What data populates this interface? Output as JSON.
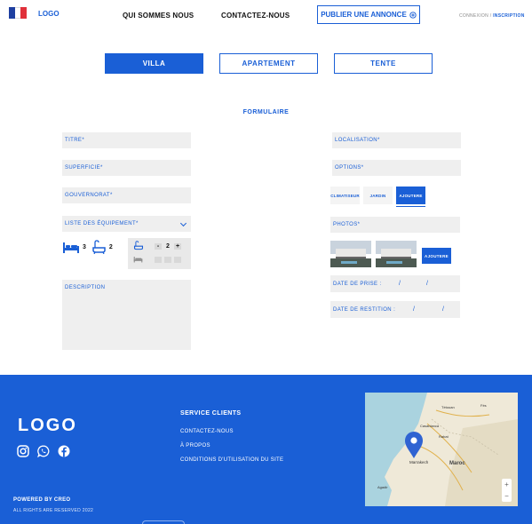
{
  "header": {
    "logo": "LOGO",
    "flag_colors": [
      "#1e3fa0",
      "#ffffff",
      "#e0303a"
    ],
    "nav": [
      {
        "label": "QUI SOMMES NOUS"
      },
      {
        "label": "CONTACTEZ-NOUS"
      }
    ],
    "publish_label": "PUBLIER UNE ANNONCE",
    "publish_icon": "plus-circle-icon",
    "login": "CONNEXION",
    "auth_separator": "/",
    "register": "INSCRIPTION"
  },
  "tabs": [
    {
      "label": "VILLA",
      "active": true
    },
    {
      "label": "APARTEMENT",
      "active": false
    },
    {
      "label": "TENTE",
      "active": false
    }
  ],
  "form": {
    "title": "FORMULAIRE",
    "left": {
      "titre": "TITRE*",
      "superficie": "SUPERFICIE*",
      "gouvernorat": "GOUVERNORAT*",
      "equipements": "LISTE DES ÉQUIPEMENT*",
      "bed_count": "3",
      "bath_count": "2",
      "stepper_value": "2",
      "stepper_minus": "-",
      "stepper_plus": "+",
      "description": "DESCRIPTION"
    },
    "right": {
      "localisation": "LOCALISATION*",
      "options": "OPTIONS*",
      "option_chips": [
        {
          "label": "CLIMATISEUR",
          "active": false
        },
        {
          "label": "JARDIN",
          "active": false
        },
        {
          "label": "AJOUTERE",
          "active": true
        }
      ],
      "photos": "PHOTOS*",
      "add_photo": "AJOUTERE",
      "date_prise": "DATE DE PRISE :",
      "date_restition": "DATE DE RESTITION :",
      "date_sep": "/"
    }
  },
  "footer": {
    "logo": "LOGO",
    "social_icons": [
      "instagram-icon",
      "whatsapp-icon",
      "facebook-icon"
    ],
    "service_heading": "SERVICE CLIENTS",
    "links": [
      {
        "label": "CONTACTEZ-NOUS"
      },
      {
        "label": "À PROPOS"
      },
      {
        "label": "CONDITIONS D'UTILISATION DU SITE"
      }
    ],
    "powered": "POWERED BY CREO",
    "rights": "ALL RIGHTS ARE RESERVED 2022",
    "map": {
      "labels": [
        "Tétouan",
        "Fès",
        "Casablanca",
        "Rabat",
        "Marrakech",
        "Maroc",
        "Agadir"
      ],
      "zoom_in": "+",
      "zoom_out": "−"
    }
  },
  "colors": {
    "accent": "#1a5fd6",
    "field_bg": "#efefef"
  }
}
